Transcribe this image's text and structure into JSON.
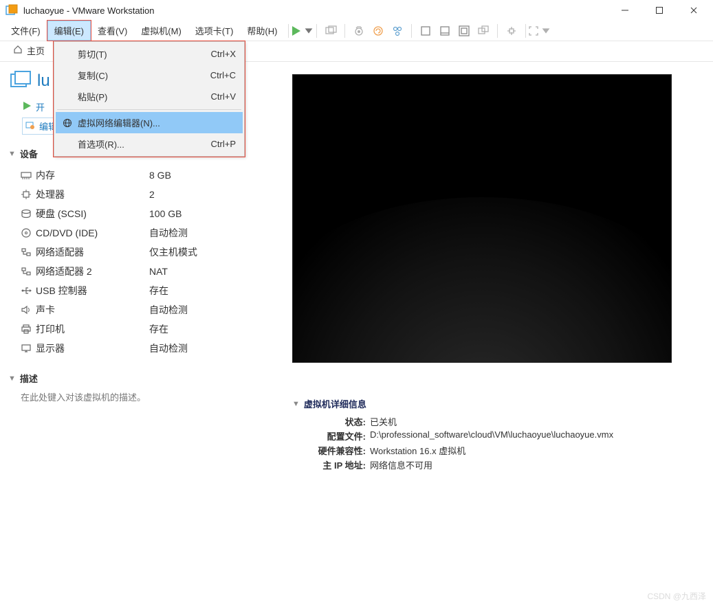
{
  "window_title": "luchaoyue - VMware Workstation",
  "menubar": {
    "file": "文件(F)",
    "edit": "编辑(E)",
    "view": "查看(V)",
    "vm": "虚拟机(M)",
    "tabs": "选项卡(T)",
    "help": "帮助(H)"
  },
  "dropdown": {
    "cut": {
      "label": "剪切(T)",
      "shortcut": "Ctrl+X"
    },
    "copy": {
      "label": "复制(C)",
      "shortcut": "Ctrl+C"
    },
    "paste": {
      "label": "粘贴(P)",
      "shortcut": "Ctrl+V"
    },
    "vne": {
      "label": "虚拟网络编辑器(N)..."
    },
    "pref": {
      "label": "首选项(R)...",
      "shortcut": "Ctrl+P"
    }
  },
  "tabs": {
    "home": "主页"
  },
  "vm": {
    "name_prefix": "lu",
    "actions": {
      "power_on": "开",
      "edit_settings": "编辑虚拟机设置"
    }
  },
  "sections": {
    "devices": "设备",
    "description": "描述",
    "desc_placeholder": "在此处键入对该虚拟机的描述。",
    "details": "虚拟机详细信息"
  },
  "devices": [
    {
      "icon": "memory",
      "label": "内存",
      "value": "8 GB"
    },
    {
      "icon": "cpu",
      "label": "处理器",
      "value": "2"
    },
    {
      "icon": "disk",
      "label": "硬盘 (SCSI)",
      "value": "100 GB"
    },
    {
      "icon": "cd",
      "label": "CD/DVD (IDE)",
      "value": "自动检测"
    },
    {
      "icon": "net",
      "label": "网络适配器",
      "value": "仅主机模式"
    },
    {
      "icon": "net",
      "label": "网络适配器 2",
      "value": "NAT"
    },
    {
      "icon": "usb",
      "label": "USB 控制器",
      "value": "存在"
    },
    {
      "icon": "sound",
      "label": "声卡",
      "value": "自动检测"
    },
    {
      "icon": "printer",
      "label": "打印机",
      "value": "存在"
    },
    {
      "icon": "display",
      "label": "显示器",
      "value": "自动检测"
    }
  ],
  "details": {
    "state_label": "状态:",
    "state_value": "已关机",
    "config_label": "配置文件:",
    "config_value": "D:\\professional_software\\cloud\\VM\\luchaoyue\\luchaoyue.vmx",
    "compat_label": "硬件兼容性:",
    "compat_value": "Workstation 16.x 虚拟机",
    "ip_label": "主 IP 地址:",
    "ip_value": "网络信息不可用"
  },
  "watermark": "CSDN @九西泽"
}
